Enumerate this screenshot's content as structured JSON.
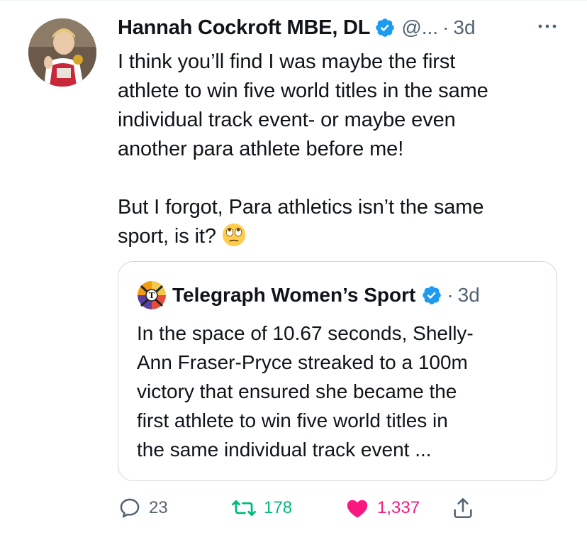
{
  "tweet": {
    "author_name": "Hannah Cockroft MBE, DL",
    "handle": "@...",
    "separator": "·",
    "time": "3d",
    "text": "I think you’ll find I was maybe the first\nathlete to win five world titles in the same\nindividual track event- or maybe even\nanother para athlete before me!\n\nBut I forgot, Para athletics isn’t the same\nsport, is it?",
    "emoji": "eye-roll-emoji"
  },
  "quote": {
    "author_name": "Telegraph Women’s Sport",
    "separator": "·",
    "time": "3d",
    "text": "In the space of 10.67 seconds, Shelly-\nAnn Fraser-Pryce streaked to a 100m\nvictory that ensured she became the\nfirst athlete to win five world titles in\nthe same individual track event ..."
  },
  "actions": {
    "reply_count": "23",
    "retweet_count": "178",
    "like_count": "1,337"
  },
  "colors": {
    "verified": "#1d9bf0",
    "retweet_active": "#00ba7c",
    "like_active": "#f91880",
    "secondary_text": "#536471"
  },
  "icons": [
    "verified-badge-icon",
    "more-icon",
    "reply-icon",
    "retweet-icon",
    "heart-icon",
    "share-icon"
  ]
}
